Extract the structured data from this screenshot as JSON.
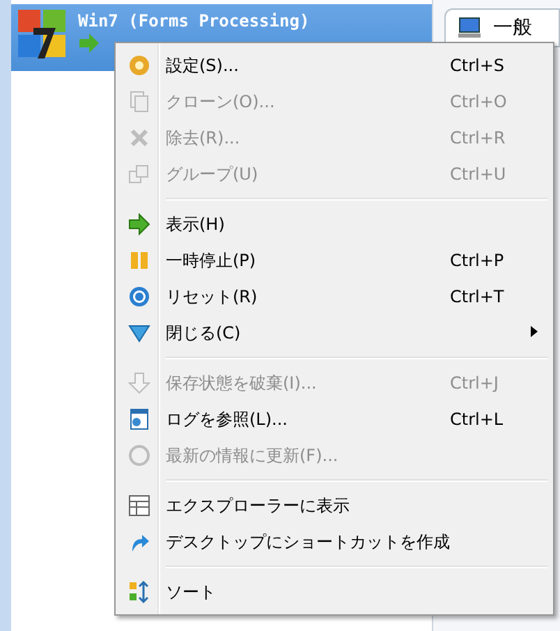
{
  "vm_list": {
    "items": [
      {
        "name": "Win7 (Forms Processing)",
        "selected": true
      }
    ]
  },
  "details_tab": {
    "label": "一般"
  },
  "context_menu": {
    "groups": [
      [
        {
          "label": "設定(S)...",
          "shortcut": "Ctrl+S",
          "disabled": false
        },
        {
          "label": "クローン(O)...",
          "shortcut": "Ctrl+O",
          "disabled": true
        },
        {
          "label": "除去(R)...",
          "shortcut": "Ctrl+R",
          "disabled": true
        },
        {
          "label": "グループ(U)",
          "shortcut": "Ctrl+U",
          "disabled": true
        }
      ],
      [
        {
          "label": "表示(H)",
          "disabled": false
        },
        {
          "label": "一時停止(P)",
          "shortcut": "Ctrl+P",
          "disabled": false
        },
        {
          "label": "リセット(R)",
          "shortcut": "Ctrl+T",
          "disabled": false
        },
        {
          "label": "閉じる(C)",
          "disabled": false,
          "submenu": true
        }
      ],
      [
        {
          "label": "保存状態を破棄(I)...",
          "shortcut": "Ctrl+J",
          "disabled": true
        },
        {
          "label": "ログを参照(L)...",
          "shortcut": "Ctrl+L",
          "disabled": false
        },
        {
          "label": "最新の情報に更新(F)...",
          "disabled": true
        }
      ],
      [
        {
          "label": "エクスプローラーに表示",
          "disabled": false
        },
        {
          "label": "デスクトップにショートカットを作成",
          "disabled": false
        }
      ],
      [
        {
          "label": "ソート",
          "disabled": false
        }
      ]
    ]
  }
}
